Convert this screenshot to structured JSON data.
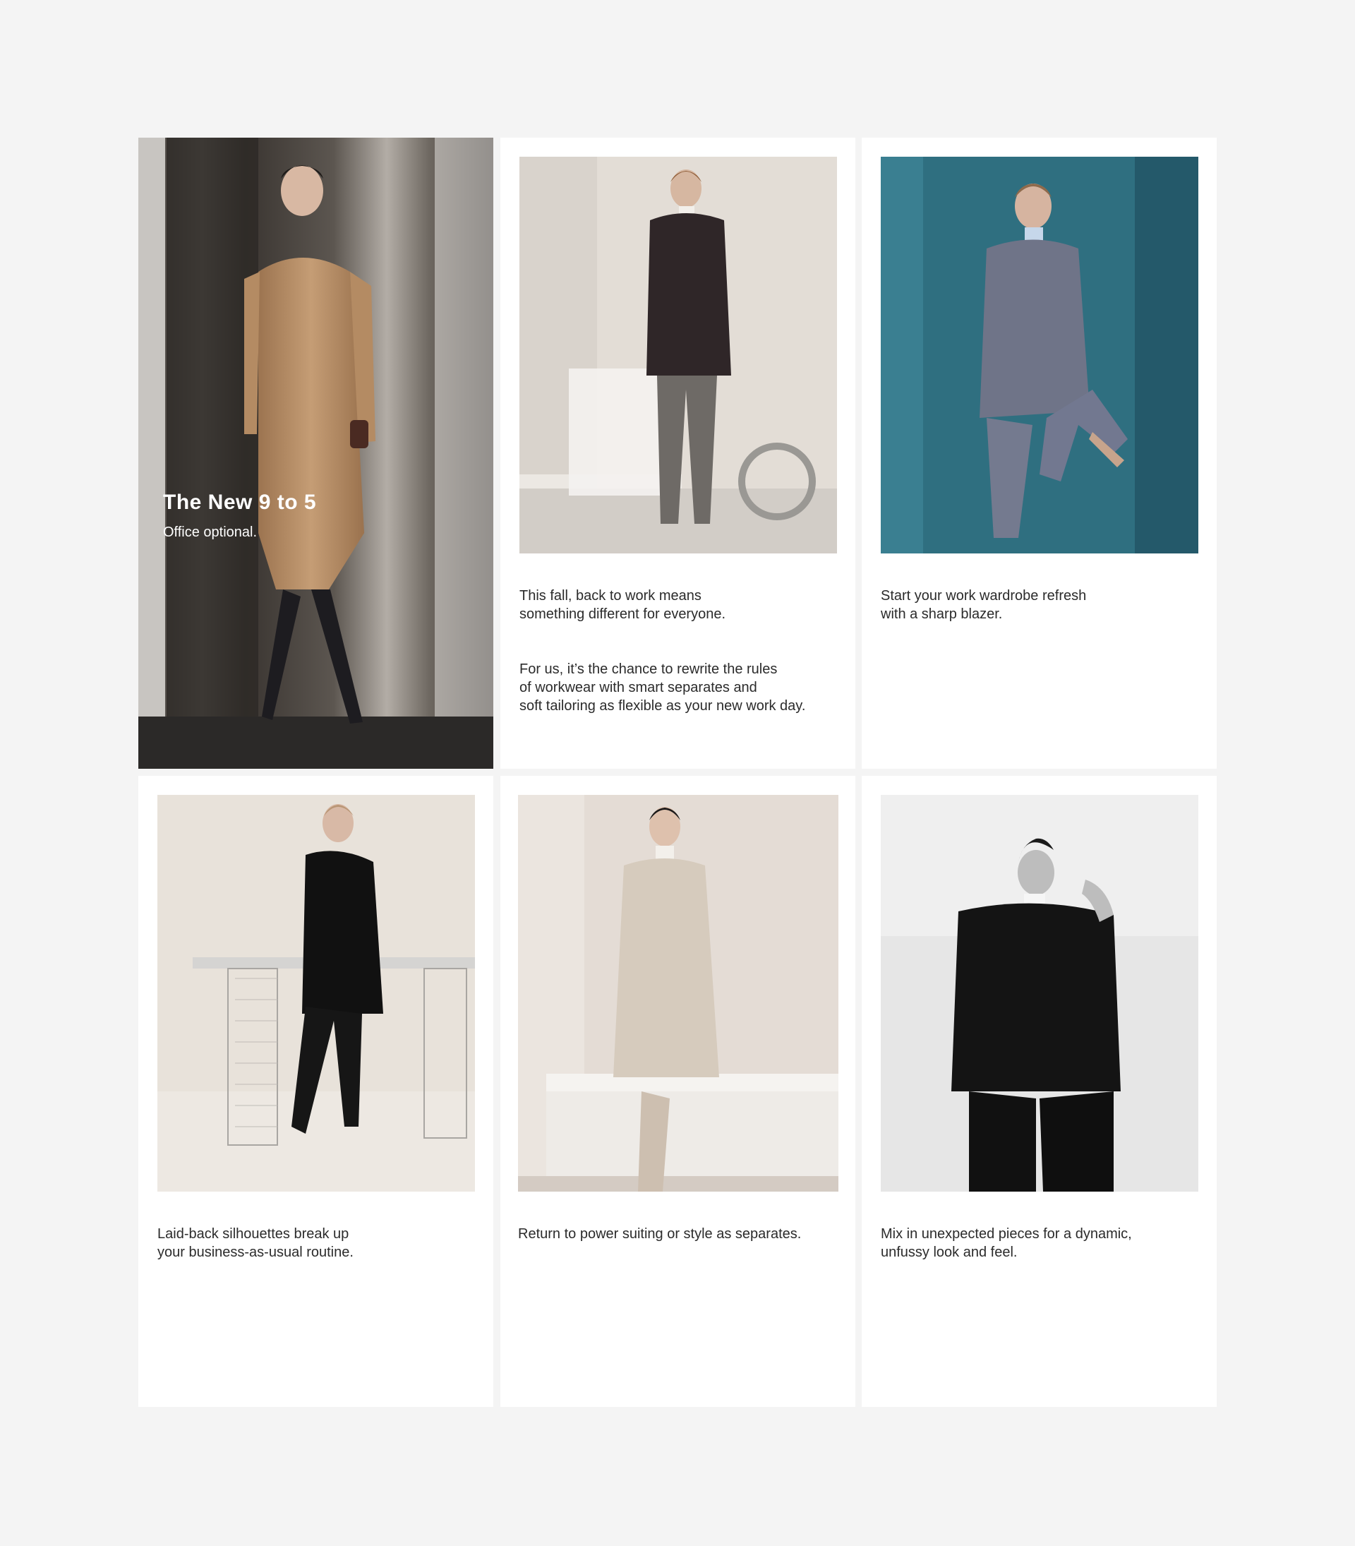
{
  "page": {
    "background": "#f4f4f4",
    "card_background": "#ffffff"
  },
  "hero": {
    "title": "The New 9 to 5",
    "subtitle": "Office optional.",
    "image": "model-in-camel-coat-at-elevator"
  },
  "cards": [
    {
      "image": "model-in-dark-double-breasted-blazer",
      "paragraphs": [
        "This fall, back to work means\nsomething different for everyone.",
        "For us, it’s the chance to rewrite the rules\nof workwear with smart separates and\nsoft tailoring as flexible as your new work day."
      ]
    },
    {
      "image": "model-in-grey-suit-teal-background",
      "paragraphs": [
        "Start your work wardrobe refresh\nwith a sharp blazer."
      ]
    },
    {
      "image": "model-in-black-shirt-leaning-on-glass-desk",
      "paragraphs": [
        "Laid-back silhouettes break up\nyour business-as-usual routine."
      ]
    },
    {
      "image": "model-in-beige-suit-at-white-desk",
      "paragraphs": [
        "Return to power suiting or style as separates."
      ]
    },
    {
      "image": "model-in-black-hoodie-black-and-white",
      "paragraphs": [
        "Mix in unexpected pieces for a dynamic,\nunfussy look and feel."
      ]
    }
  ]
}
